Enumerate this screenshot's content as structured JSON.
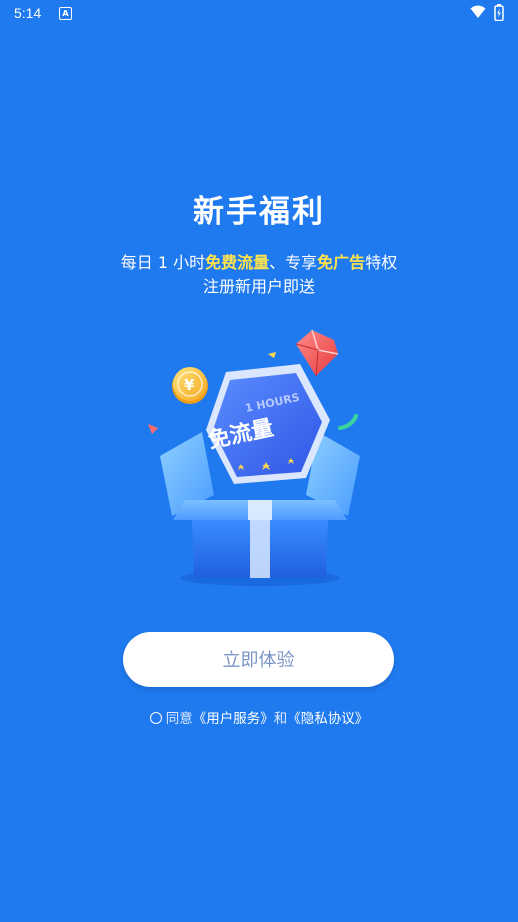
{
  "status_bar": {
    "time": "5:14"
  },
  "welcome": {
    "title": "新手福利",
    "subtitle_part1": "每日 1 小时",
    "subtitle_highlight1": "免费流量",
    "subtitle_part2": "、专享",
    "subtitle_highlight2": "免广告",
    "subtitle_part3": "特权",
    "subtitle_line2": "注册新用户即送",
    "highlight_color": "#ffe44d"
  },
  "illustration": {
    "badge_top_text": "1 HOURS",
    "badge_main_text": "免流量",
    "coin_symbol": "¥"
  },
  "cta": {
    "label": "立即体验"
  },
  "agreement": {
    "prefix": "同意",
    "link1": "《用户服务》",
    "conjunction": "和",
    "link2": "《隐私协议》"
  },
  "colors": {
    "background": "#1f7af0",
    "button_text": "#7a95c6"
  }
}
